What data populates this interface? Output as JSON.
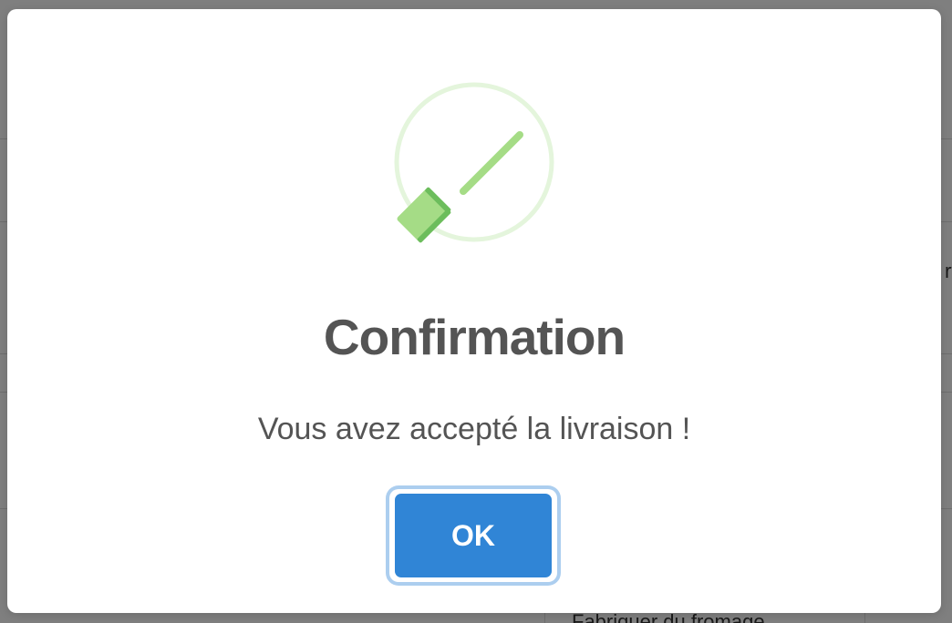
{
  "background": {
    "partial_text_right": "rt",
    "partial_text_bottom": "Fabriquer du fromage"
  },
  "modal": {
    "icon": "success-check-icon",
    "title": "Confirmation",
    "message": "Vous avez accepté la livraison !",
    "confirm_label": "OK"
  },
  "colors": {
    "confirm_button": "#3085d6",
    "success_icon": "#a5dc86",
    "title_text": "#545454"
  }
}
